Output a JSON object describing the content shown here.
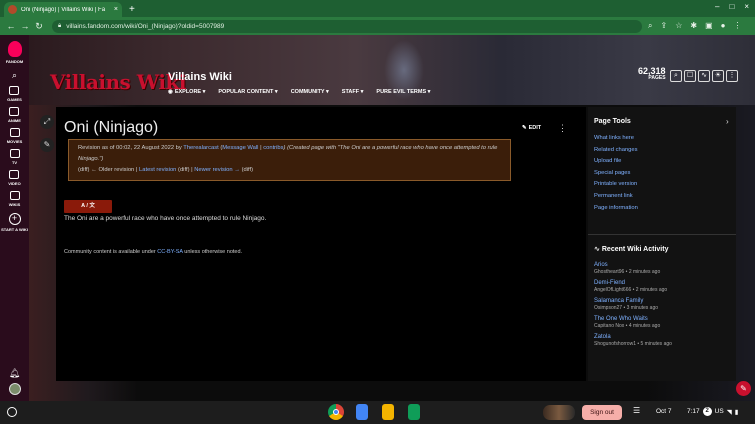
{
  "browser": {
    "tab_title": "Oni (Ninjago) | Villains Wiki | Fa",
    "tab_close": "×",
    "new_tab": "+",
    "url": "villains.fandom.com/wiki/Oni_(Ninjago)?oldid=5007989",
    "nav": {
      "back": "←",
      "forward": "→",
      "reload": "↻"
    },
    "window_controls": {
      "minimize": "–",
      "maximize": "□",
      "close": "×"
    }
  },
  "rail": {
    "logo_label": "FANDOM",
    "items": [
      {
        "label": "GAMES"
      },
      {
        "label": "ANIME"
      },
      {
        "label": "MOVIES"
      },
      {
        "label": "TV"
      },
      {
        "label": "VIDEO"
      },
      {
        "label": "WIKIS"
      }
    ],
    "start_label": "START A WIKI"
  },
  "wiki": {
    "logo_text": "Villains Wiki",
    "name": "Villains Wiki",
    "nav": [
      "EXPLORE ▾",
      "POPULAR CONTENT ▾",
      "COMMUNITY ▾",
      "STAFF ▾",
      "PURE EVIL TERMS ▾"
    ],
    "pages_count": "62,318",
    "pages_label": "PAGES"
  },
  "article": {
    "title": "Oni (Ninjago)",
    "edit_label": "EDIT",
    "revision": {
      "prefix": "Revision as of 00:02, 22 August 2022 by ",
      "user": "Therealarcast",
      "paren_open": " (",
      "message_wall": "Message Wall",
      "sep1": " | ",
      "contribs": "contribs",
      "summary": ") (Created page with \"The Oni are a powerful race who have once attempted to rule Ninjago.\")",
      "diff1": "(diff)",
      "older": " ← Older revision | ",
      "latest": "Latest revision",
      "diff2": " (diff)",
      "sep2": " | ",
      "newer": "Newer revision →",
      "diff3": " (diff)"
    },
    "red_button": "A / 文",
    "body": "The Oni are a powerful race who have once attempted to rule Ninjago.",
    "license_pre": "Community content is available under ",
    "license_link": "CC-BY-SA",
    "license_post": " unless otherwise noted."
  },
  "page_tools": {
    "title": "Page Tools",
    "items": [
      "What links here",
      "Related changes",
      "Upload file",
      "Special pages",
      "Printable version",
      "Permanent link",
      "Page information"
    ]
  },
  "recent_activity": {
    "title": "Recent Wiki Activity",
    "items": [
      {
        "page": "Arios",
        "meta": "Ghostheart96 • 2 minutes ago"
      },
      {
        "page": "Demi-Fiend",
        "meta": "AngelOfLight666 • 2 minutes ago"
      },
      {
        "page": "Salamanca Family",
        "meta": "Osimpson27 • 3 minutes ago"
      },
      {
        "page": "The One Who Waits",
        "meta": "Capitano Nox • 4 minutes ago"
      },
      {
        "page": "Zatola",
        "meta": "Shogunofshorrow1 • 5 minutes ago"
      }
    ]
  },
  "shelf": {
    "sign_out": "Sign out",
    "date": "Oct 7",
    "time": "7:17",
    "badge": "2",
    "lang": "US"
  },
  "colors": {
    "tab_green": "#2b7a3f",
    "fandom_red": "#c8102e",
    "link": "#7fb1ff"
  }
}
